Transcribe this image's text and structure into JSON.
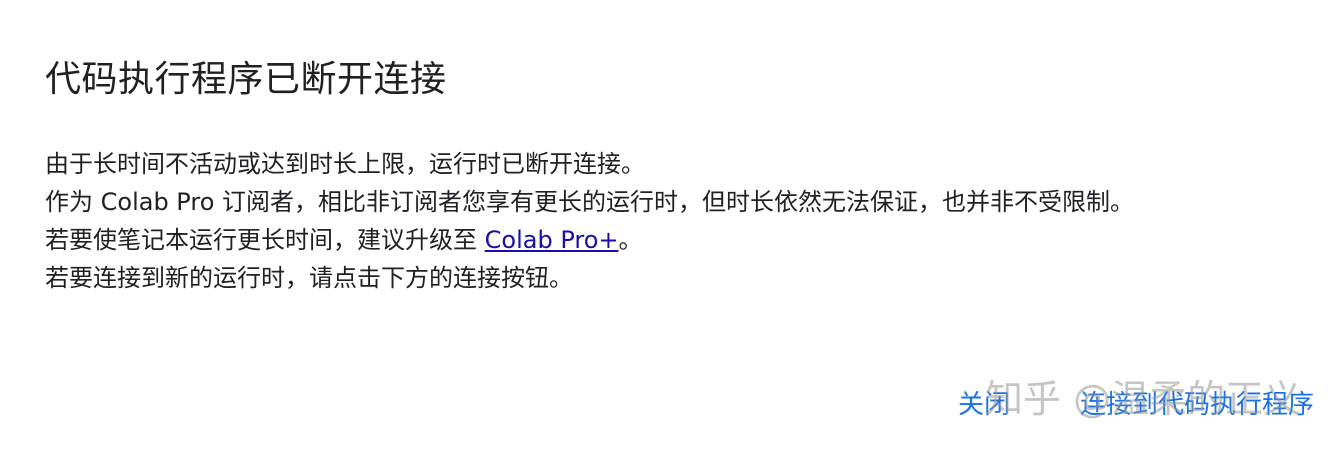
{
  "dialog": {
    "title": "代码执行程序已断开连接",
    "lines": [
      "由于长时间不活动或达到时长上限，运行时已断开连接。",
      "作为 Colab Pro 订阅者，相比非订阅者您享有更长的运行时，但时长依然无法保证，也并非不受限制。"
    ],
    "line3_prefix": "若要使笔记本运行更长时间，建议升级至 ",
    "line3_link": "Colab Pro+",
    "line3_suffix": "。",
    "line4": "若要连接到新的运行时，请点击下方的连接按钮。",
    "close_label": "关闭",
    "connect_label": "连接到代码执行程序"
  },
  "watermark": "知乎 @温柔的正义",
  "colors": {
    "accent": "#1a73e8",
    "link": "#1a0dab"
  }
}
